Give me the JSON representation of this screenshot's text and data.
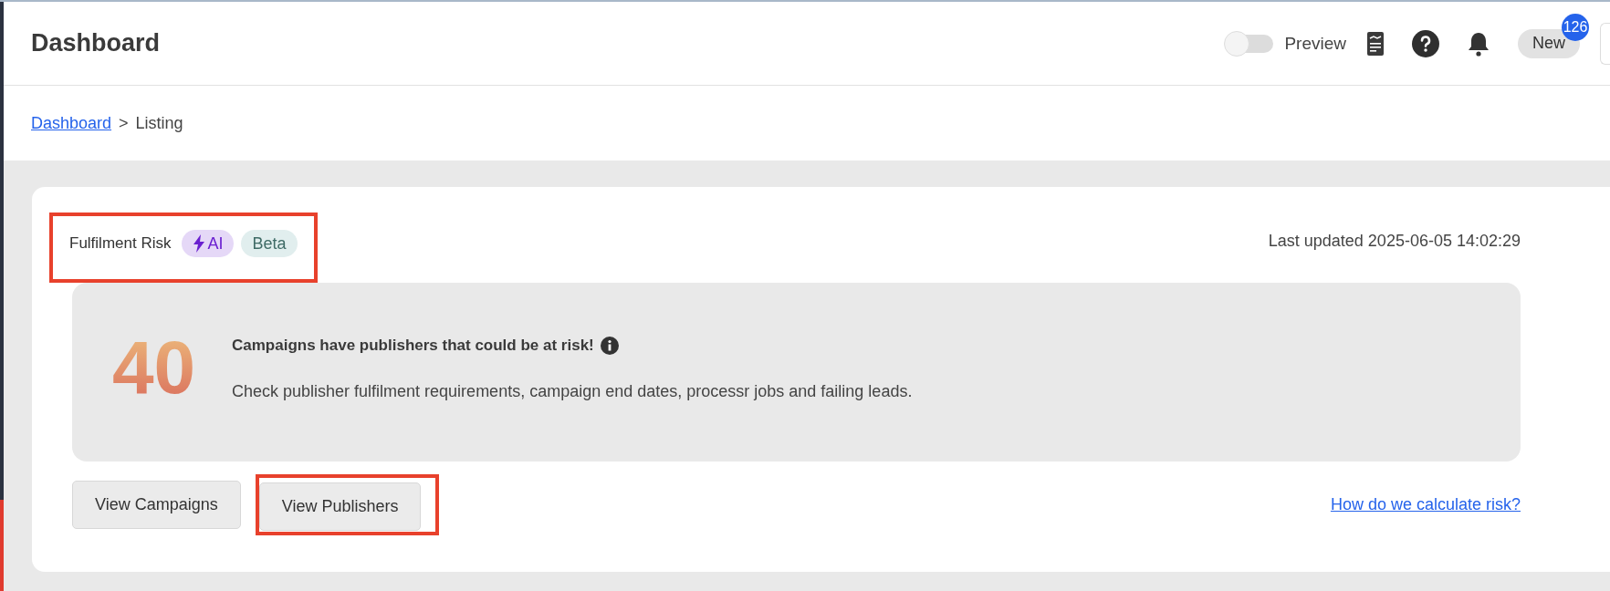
{
  "header": {
    "title": "Dashboard",
    "preview_toggle": {
      "label": "Preview",
      "on": false
    },
    "new_button": {
      "label": "New",
      "badge": "126"
    }
  },
  "breadcrumb": [
    {
      "label": "Dashboard",
      "kind": "link"
    },
    {
      "label": ">",
      "kind": "separator"
    },
    {
      "label": "Listing",
      "kind": "current"
    }
  ],
  "risk_card": {
    "title": "Fulfilment Risk",
    "tags": [
      {
        "label": "AI",
        "kind": "ai"
      },
      {
        "label": "Beta",
        "kind": "beta"
      }
    ],
    "last_updated": "Last updated 2025-06-05 14:02:29",
    "count": "40",
    "headline": "Campaigns have publishers that could be at risk!",
    "description": "Check publisher fulfilment requirements, campaign end dates, processr jobs and failing leads.",
    "buttons": [
      {
        "label": "View Campaigns",
        "highlighted": false
      },
      {
        "label": "View Publishers",
        "highlighted": true
      }
    ],
    "link": "How do we calculate risk?"
  }
}
